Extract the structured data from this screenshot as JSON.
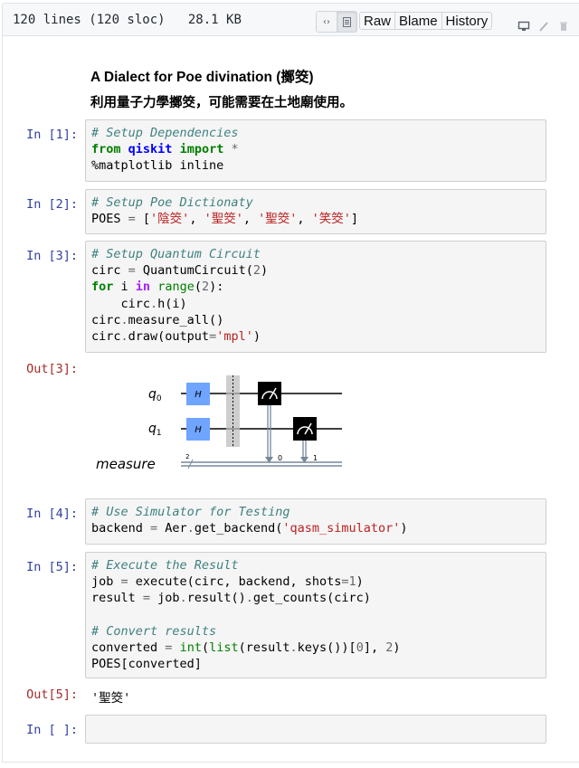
{
  "file_header": {
    "lines": "120 lines (120 sloc)",
    "size": "28.1 KB",
    "view_toggle": [
      {
        "icon": "code-icon",
        "glyph": "‹›",
        "active": false
      },
      {
        "icon": "file-icon",
        "glyph": "▤",
        "active": true
      }
    ],
    "buttons": [
      "Raw",
      "Blame",
      "History"
    ],
    "actions": [
      "desktop-icon",
      "pencil-icon",
      "trash-icon"
    ]
  },
  "markdown": {
    "title": "A Dialect for Poe divination (擲筊)",
    "subtitle": "利用量子力學擲筊，可能需要在土地廟使用。"
  },
  "cells": [
    {
      "prompt": "In [1]:",
      "lines": [
        [
          {
            "t": "# Setup Dependencies",
            "c": "cm"
          }
        ],
        [
          {
            "t": "from",
            "c": "kw"
          },
          {
            "t": " "
          },
          {
            "t": "qiskit",
            "c": "nn"
          },
          {
            "t": " "
          },
          {
            "t": "import",
            "c": "kw"
          },
          {
            "t": " "
          },
          {
            "t": "*",
            "c": "op"
          }
        ],
        [
          {
            "t": "%matplotlib inline"
          }
        ]
      ]
    },
    {
      "prompt": "In [2]:",
      "lines": [
        [
          {
            "t": "# Setup Poe Dictionaty",
            "c": "cm"
          }
        ],
        [
          {
            "t": "POES "
          },
          {
            "t": "=",
            "c": "op"
          },
          {
            "t": " ["
          },
          {
            "t": "'陰筊'",
            "c": "st"
          },
          {
            "t": ", "
          },
          {
            "t": "'聖筊'",
            "c": "st"
          },
          {
            "t": ", "
          },
          {
            "t": "'聖筊'",
            "c": "st"
          },
          {
            "t": ", "
          },
          {
            "t": "'笑筊'",
            "c": "st"
          },
          {
            "t": "]"
          }
        ]
      ]
    },
    {
      "prompt": "In [3]:",
      "lines": [
        [
          {
            "t": "# Setup Quantum Circuit",
            "c": "cm"
          }
        ],
        [
          {
            "t": "circ "
          },
          {
            "t": "=",
            "c": "op"
          },
          {
            "t": " QuantumCircuit("
          },
          {
            "t": "2",
            "c": "mi"
          },
          {
            "t": ")"
          }
        ],
        [
          {
            "t": "for",
            "c": "kw"
          },
          {
            "t": " i "
          },
          {
            "t": "in",
            "c": "ow"
          },
          {
            "t": " "
          },
          {
            "t": "range",
            "c": "nb"
          },
          {
            "t": "("
          },
          {
            "t": "2",
            "c": "mi"
          },
          {
            "t": "):"
          }
        ],
        [
          {
            "t": "    circ"
          },
          {
            "t": ".",
            "c": "op"
          },
          {
            "t": "h(i)"
          }
        ],
        [
          {
            "t": "circ"
          },
          {
            "t": ".",
            "c": "op"
          },
          {
            "t": "measure_all()"
          }
        ],
        [
          {
            "t": "circ"
          },
          {
            "t": ".",
            "c": "op"
          },
          {
            "t": "draw(output"
          },
          {
            "t": "=",
            "c": "op"
          },
          {
            "t": "'mpl'",
            "c": "st"
          },
          {
            "t": ")"
          }
        ]
      ]
    },
    {
      "prompt": "In [4]:",
      "lines": [
        [
          {
            "t": "# Use Simulator for Testing",
            "c": "cm"
          }
        ],
        [
          {
            "t": "backend "
          },
          {
            "t": "=",
            "c": "op"
          },
          {
            "t": " Aer"
          },
          {
            "t": ".",
            "c": "op"
          },
          {
            "t": "get_backend("
          },
          {
            "t": "'qasm_simulator'",
            "c": "st"
          },
          {
            "t": ")"
          }
        ]
      ]
    },
    {
      "prompt": "In [5]:",
      "lines": [
        [
          {
            "t": "# Execute the Result",
            "c": "cm"
          }
        ],
        [
          {
            "t": "job "
          },
          {
            "t": "=",
            "c": "op"
          },
          {
            "t": " execute(circ, backend, shots"
          },
          {
            "t": "=",
            "c": "op"
          },
          {
            "t": "1",
            "c": "mi"
          },
          {
            "t": ")"
          }
        ],
        [
          {
            "t": "result "
          },
          {
            "t": "=",
            "c": "op"
          },
          {
            "t": " job"
          },
          {
            "t": ".",
            "c": "op"
          },
          {
            "t": "result()"
          },
          {
            "t": ".",
            "c": "op"
          },
          {
            "t": "get_counts(circ)"
          }
        ],
        [
          {
            "t": ""
          }
        ],
        [
          {
            "t": "# Convert results",
            "c": "cm"
          }
        ],
        [
          {
            "t": "converted "
          },
          {
            "t": "=",
            "c": "op"
          },
          {
            "t": " "
          },
          {
            "t": "int",
            "c": "nb"
          },
          {
            "t": "("
          },
          {
            "t": "list",
            "c": "nb"
          },
          {
            "t": "(result"
          },
          {
            "t": ".",
            "c": "op"
          },
          {
            "t": "keys())["
          },
          {
            "t": "0",
            "c": "mi"
          },
          {
            "t": "], "
          },
          {
            "t": "2",
            "c": "mi"
          },
          {
            "t": ")"
          }
        ],
        [
          {
            "t": "POES[converted]"
          }
        ]
      ]
    },
    {
      "prompt": "In [ ]:",
      "lines": []
    }
  ],
  "outputs": {
    "out3_prompt": "Out[3]:",
    "out5_prompt": "Out[5]:",
    "out5_value": "'聖筊'"
  },
  "circuit": {
    "qubits": [
      "q",
      "q"
    ],
    "qubit_subs": [
      "0",
      "1"
    ],
    "gate_label": "H",
    "classical_label": "measure",
    "classical_width": "2",
    "measure_bits": [
      "0",
      "1"
    ],
    "colors": {
      "gate": "#6fa4ff",
      "measure": "#000000",
      "wire": "#000000",
      "classical": "#778899",
      "barrier": "#bdbdbd"
    }
  }
}
